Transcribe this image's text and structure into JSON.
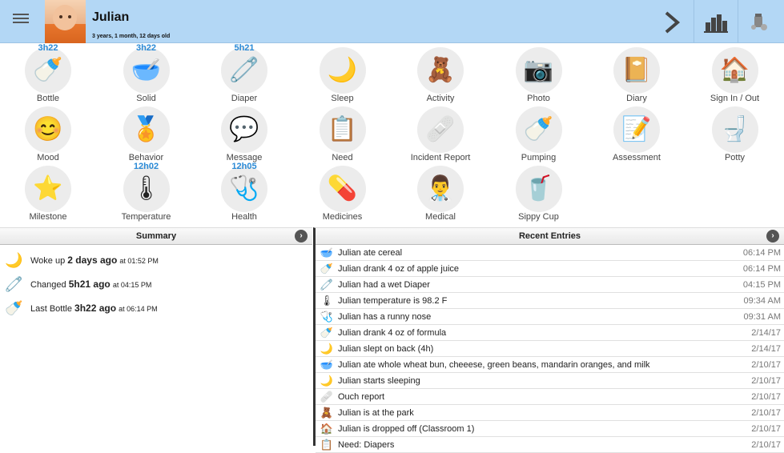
{
  "header": {
    "child_name": "Julian",
    "child_age": "3 years, 1 month, 12 days old",
    "menu_icon": "hamburger-icon",
    "next_icon": "chevron-right-icon",
    "stats_icon": "bar-chart-icon",
    "med_icon": "medication-icon"
  },
  "tiles": [
    {
      "label": "Bottle",
      "timer": "3h22",
      "icon": "🍼"
    },
    {
      "label": "Solid",
      "timer": "3h22",
      "icon": "🥣"
    },
    {
      "label": "Diaper",
      "timer": "5h21",
      "icon": "🧷"
    },
    {
      "label": "Sleep",
      "timer": "",
      "icon": "🌙"
    },
    {
      "label": "Activity",
      "timer": "",
      "icon": "🧸"
    },
    {
      "label": "Photo",
      "timer": "",
      "icon": "📷"
    },
    {
      "label": "Diary",
      "timer": "",
      "icon": "📔"
    },
    {
      "label": "Sign In / Out",
      "timer": "",
      "icon": "🏠"
    },
    {
      "label": "Mood",
      "timer": "",
      "icon": "😊"
    },
    {
      "label": "Behavior",
      "timer": "",
      "icon": "🏅"
    },
    {
      "label": "Message",
      "timer": "",
      "icon": "💬"
    },
    {
      "label": "Need",
      "timer": "",
      "icon": "📋"
    },
    {
      "label": "Incident Report",
      "timer": "",
      "icon": "🩹"
    },
    {
      "label": "Pumping",
      "timer": "",
      "icon": "🍼"
    },
    {
      "label": "Assessment",
      "timer": "",
      "icon": "📝"
    },
    {
      "label": "Potty",
      "timer": "",
      "icon": "🚽"
    },
    {
      "label": "Milestone",
      "timer": "",
      "icon": "⭐"
    },
    {
      "label": "Temperature",
      "timer": "12h02",
      "icon": "🌡"
    },
    {
      "label": "Health",
      "timer": "12h05",
      "icon": "🩺"
    },
    {
      "label": "Medicines",
      "timer": "",
      "icon": "💊"
    },
    {
      "label": "Medical",
      "timer": "",
      "icon": "👨‍⚕️"
    },
    {
      "label": "Sippy Cup",
      "timer": "",
      "icon": "🥤"
    }
  ],
  "summary": {
    "title": "Summary",
    "rows": [
      {
        "icon": "🌙",
        "prefix": "Woke up",
        "bold": "2 days ago",
        "suffix": "at 01:52 PM"
      },
      {
        "icon": "🧷",
        "prefix": "Changed",
        "bold": "5h21 ago",
        "suffix": "at 04:15 PM"
      },
      {
        "icon": "🍼",
        "prefix": "Last Bottle",
        "bold": "3h22 ago",
        "suffix": "at 06:14 PM"
      }
    ]
  },
  "recent": {
    "title": "Recent Entries",
    "rows": [
      {
        "icon": "🥣",
        "text": "Julian ate cereal",
        "time": "06:14 PM"
      },
      {
        "icon": "🍼",
        "text": "Julian drank 4 oz of apple juice",
        "time": "06:14 PM"
      },
      {
        "icon": "🧷",
        "text": "Julian had a wet Diaper",
        "time": "04:15 PM"
      },
      {
        "icon": "🌡",
        "text": "Julian temperature is 98.2 F",
        "time": "09:34 AM"
      },
      {
        "icon": "🩺",
        "text": "Julian has a runny nose",
        "time": "09:31 AM"
      },
      {
        "icon": "🍼",
        "text": "Julian drank 4 oz of formula",
        "time": "2/14/17"
      },
      {
        "icon": "🌙",
        "text": "Julian slept on back (4h)",
        "time": "2/14/17"
      },
      {
        "icon": "🥣",
        "text": "Julian ate whole wheat bun, cheeese, green beans, mandarin oranges, and milk",
        "time": "2/10/17"
      },
      {
        "icon": "🌙",
        "text": "Julian starts sleeping",
        "time": "2/10/17"
      },
      {
        "icon": "🩹",
        "text": "Ouch report",
        "time": "2/10/17"
      },
      {
        "icon": "🧸",
        "text": "Julian is at the park",
        "time": "2/10/17"
      },
      {
        "icon": "🏠",
        "text": "Julian is dropped off (Classroom 1)",
        "time": "2/10/17"
      },
      {
        "icon": "📋",
        "text": "Need: Diapers",
        "time": "2/10/17"
      }
    ]
  }
}
